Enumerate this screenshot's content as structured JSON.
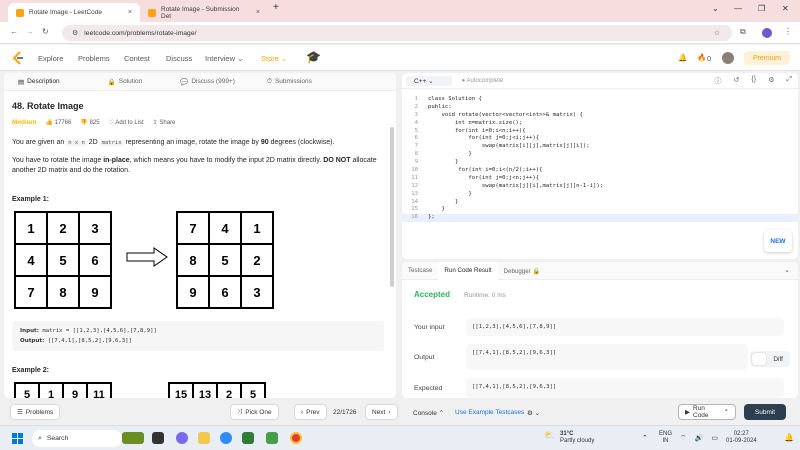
{
  "browser": {
    "tabs": [
      {
        "title": "Rotate Image - LeetCode",
        "close": "×"
      },
      {
        "title": "Rotate Image - Submission Det",
        "close": "×"
      }
    ],
    "new_tab": "+",
    "url": "leetcode.com/problems/rotate-image/",
    "window": {
      "chevron": "⌄",
      "minimize": "—",
      "maximize": "❐",
      "close": "✕"
    }
  },
  "navbar": {
    "links": [
      "Explore",
      "Problems",
      "Contest",
      "Discuss",
      "Interview ⌄",
      "Store ⌄"
    ],
    "streak_count": "0",
    "premium": "Premium"
  },
  "problem_tabs": [
    "Description",
    "Solution",
    "Discuss (999+)",
    "Submissions"
  ],
  "problem": {
    "title": "48. Rotate Image",
    "difficulty": "Medium",
    "likes": "17766",
    "dislikes": "825",
    "add_to_list": "Add to List",
    "share": "Share",
    "desc1_a": "You are given an ",
    "desc1_code": "n x n",
    "desc1_b": " 2D ",
    "desc1_code2": "matrix",
    "desc1_c": " representing an image, rotate the image by ",
    "desc1_bold": "90",
    "desc1_d": " degrees (clockwise).",
    "desc2_a": "You have to rotate the image ",
    "desc2_link": "in-place",
    "desc2_b": ", which means you have to modify the input 2D matrix directly. ",
    "desc2_bold": "DO NOT",
    "desc2_c": " allocate another 2D matrix and do the rotation.",
    "example1_title": "Example 1:",
    "example1_input_grid": [
      "1",
      "2",
      "3",
      "4",
      "5",
      "6",
      "7",
      "8",
      "9"
    ],
    "example1_output_grid": [
      "7",
      "4",
      "1",
      "8",
      "5",
      "2",
      "9",
      "6",
      "3"
    ],
    "example1_input_label": "Input:",
    "example1_input": "matrix = [[1,2,3],[4,5,6],[7,8,9]]",
    "example1_output_label": "Output:",
    "example1_output": "[[7,4,1],[8,5,2],[9,6,3]]",
    "example2_title": "Example 2:",
    "example2_input_row": [
      "5",
      "1",
      "9",
      "11"
    ],
    "example2_output_row": [
      "15",
      "13",
      "2",
      "5"
    ]
  },
  "editor": {
    "language": "C++",
    "autocomplete": "Autocomplete",
    "code_lines": [
      "class Solution {",
      "public:",
      "    void rotate(vector<vector<int>>& matrix) {",
      "        int n=matrix.size();",
      "        for(int i=0;i<n;i++){",
      "            for(int j=0;j<i;j++){",
      "                swap(matrix[i][j],matrix[j][i]);",
      "            }",
      "        }",
      "         for(int i=0;i<(n/2);i++){",
      "            for(int j=0;j<n;j++){",
      "                swap(matrix[j][i],matrix[j][n-1-i]);",
      "            }",
      "        }",
      "    }",
      "};"
    ],
    "new_badge": "NEW"
  },
  "result": {
    "tabs": [
      "Testcase",
      "Run Code Result",
      "Debugger 🔒"
    ],
    "status": "Accepted",
    "runtime": "Runtime: 0 ms",
    "your_input_label": "Your input",
    "your_input": "[[1,2,3],[4,5,6],[7,8,9]]",
    "output_label": "Output",
    "output": "[[7,4,1],[8,5,2],[9,6,3]]",
    "expected_label": "Expected",
    "expected": "[[7,4,1],[8,5,2],[9,6,3]]",
    "diff": "Diff"
  },
  "bottombar": {
    "problems": "Problems",
    "pick_one": "Pick One",
    "prev": "Prev",
    "page": "22/1726",
    "next": "Next",
    "console": "Console",
    "use_example": "Use Example Testcases",
    "run_code": "Run Code",
    "submit": "Submit"
  },
  "taskbar": {
    "search": "Search",
    "temperature": "31°C",
    "weather": "Partly cloudy",
    "lang1": "ENG",
    "lang2": "IN",
    "time": "02:27",
    "date": "01-09-2024"
  }
}
